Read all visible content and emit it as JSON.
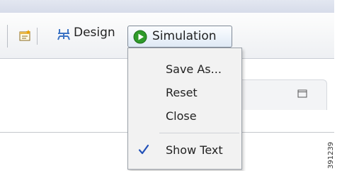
{
  "toolbar": {
    "design_label": "Design",
    "simulation_label": "Simulation",
    "icons": {
      "new_window": "window-add-icon",
      "design": "design-nodes-icon",
      "simulation": "play-icon"
    }
  },
  "menu": {
    "items": [
      {
        "label": "Save As..."
      },
      {
        "label": "Reset"
      },
      {
        "label": "Close"
      },
      {
        "label": "Show Text",
        "checked": true
      }
    ]
  },
  "figure_id": "391239",
  "colors": {
    "play_green": "#2e9a2a",
    "design_blue": "#3b73c4",
    "check_blue": "#2251b8"
  }
}
